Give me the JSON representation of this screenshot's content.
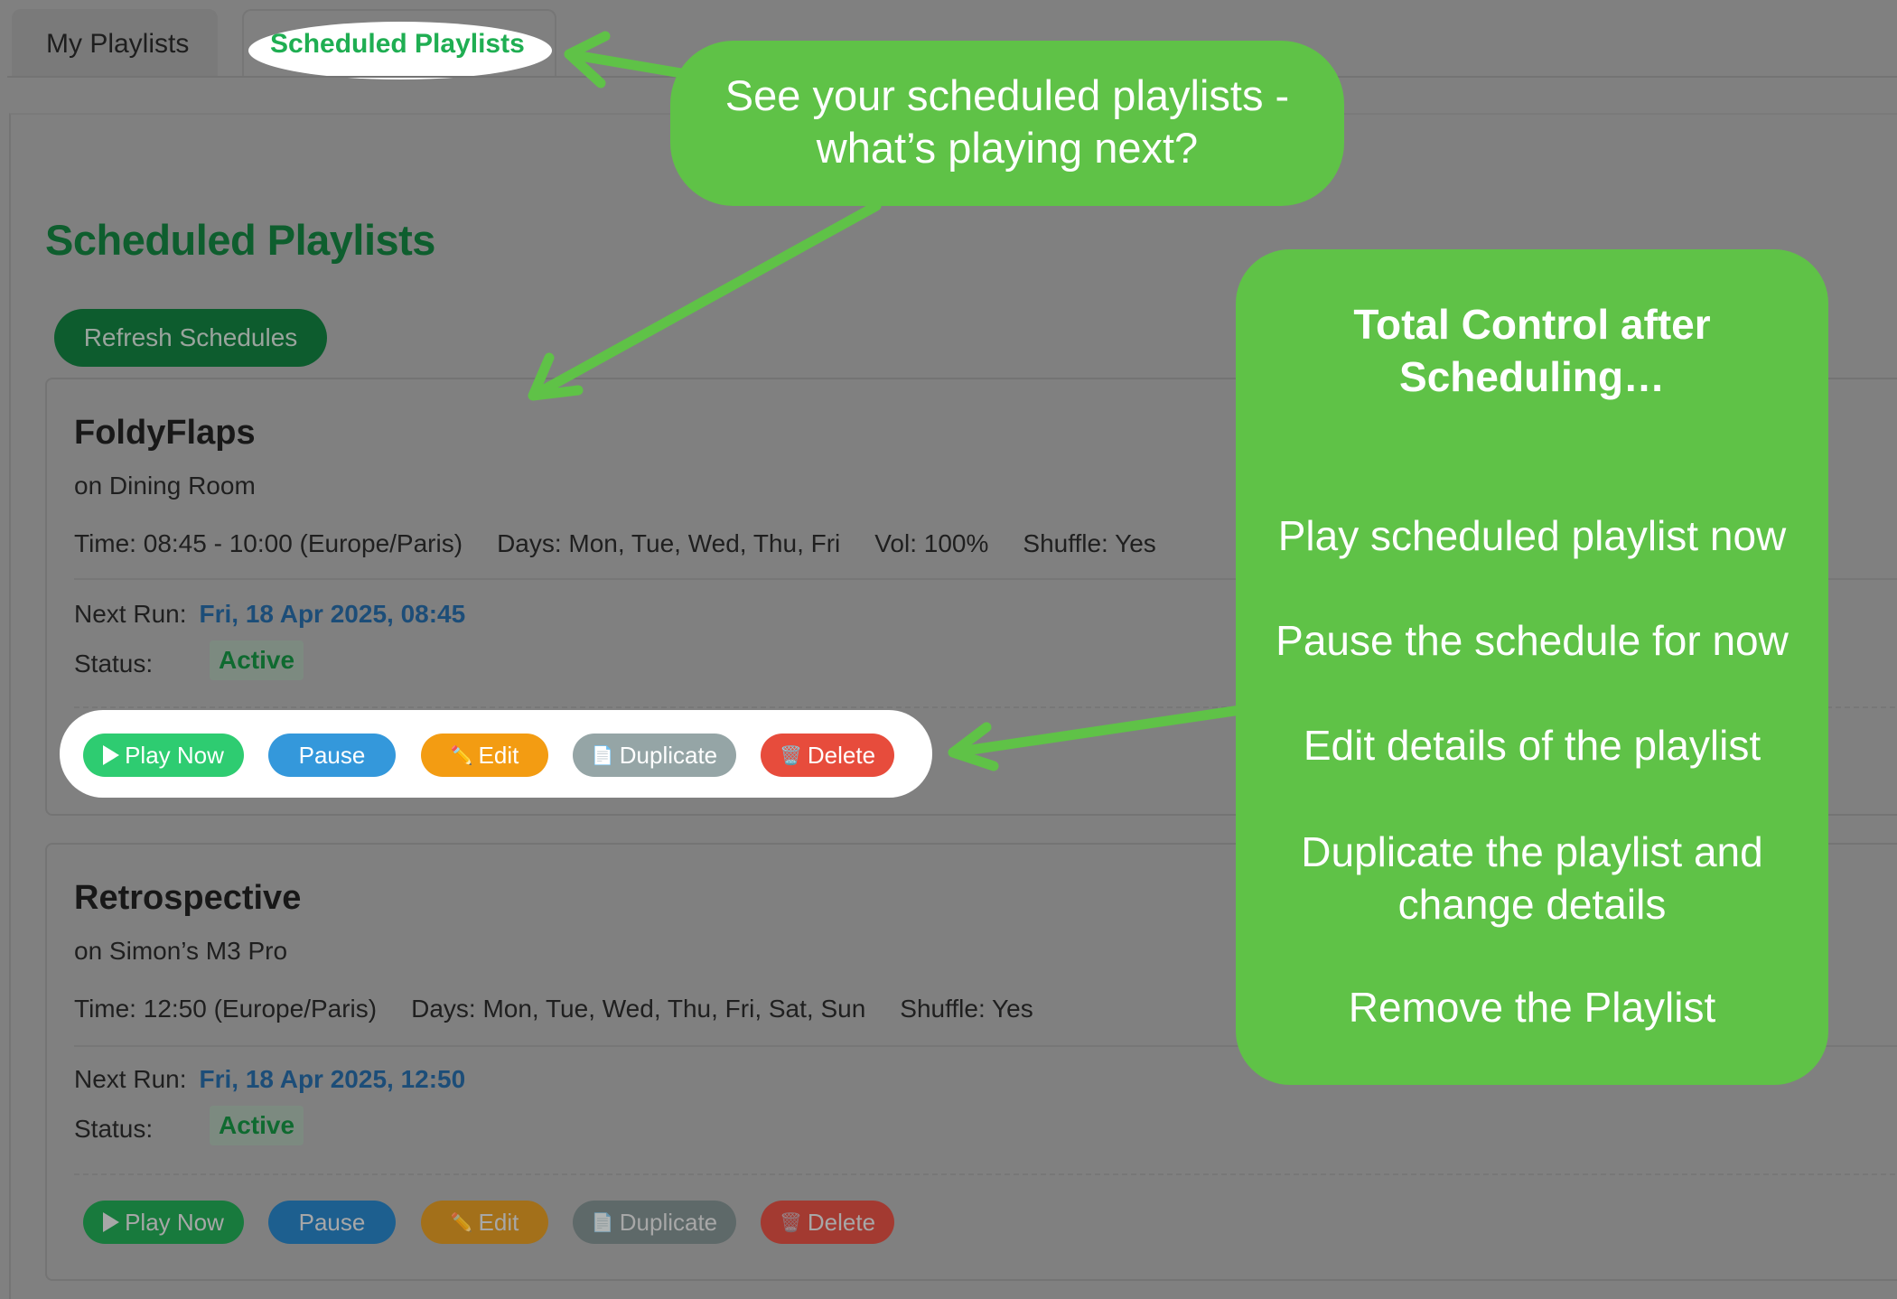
{
  "tabs": [
    {
      "label": "My Playlists",
      "active": false
    },
    {
      "label": "Scheduled Playlists",
      "active": true
    }
  ],
  "page_title": "Scheduled Playlists",
  "refresh_label": "Refresh Schedules",
  "playlists": [
    {
      "name": "FoldyFlaps",
      "device": "on Dining Room",
      "time": "Time: 08:45 - 10:00 (Europe/Paris)",
      "days": "Days: Mon, Tue, Wed, Thu, Fri",
      "volume": "Vol: 100%",
      "shuffle": "Shuffle: Yes",
      "next_run_label": "Next Run:",
      "next_run": "Fri, 18 Apr 2025, 08:45",
      "status_label": "Status:",
      "status": "Active"
    },
    {
      "name": "Retrospective",
      "device": "on Simon’s M3 Pro",
      "time": "Time: 12:50 (Europe/Paris)",
      "days": "Days: Mon, Tue, Wed, Thu, Fri, Sat, Sun",
      "shuffle": "Shuffle: Yes",
      "next_run_label": "Next Run:",
      "next_run": "Fri, 18 Apr 2025, 12:50",
      "status_label": "Status:",
      "status": "Active"
    }
  ],
  "buttons": {
    "play": "Play Now",
    "pause": "Pause",
    "edit": "Edit",
    "duplicate": "Duplicate",
    "delete": "Delete"
  },
  "icons": {
    "play": "play-triangle",
    "edit": "✏️",
    "duplicate": "📄",
    "delete": "🗑️"
  },
  "callouts": {
    "top": [
      "See your scheduled playlists -",
      "what’s playing next?"
    ],
    "side_title": [
      "Total Control after",
      "Scheduling…"
    ],
    "side_items": [
      "Play scheduled playlist now",
      "Pause the schedule for now",
      "Edit details of the playlist",
      "Duplicate the playlist and change details",
      "Remove the Playlist"
    ]
  },
  "colors": {
    "callout": "#5fc247",
    "brand_green": "#0e5e2e",
    "play": "#2ecc71",
    "pause": "#3498db",
    "edit": "#f39c12",
    "duplicate": "#95a5a6",
    "delete": "#e74c3c"
  }
}
